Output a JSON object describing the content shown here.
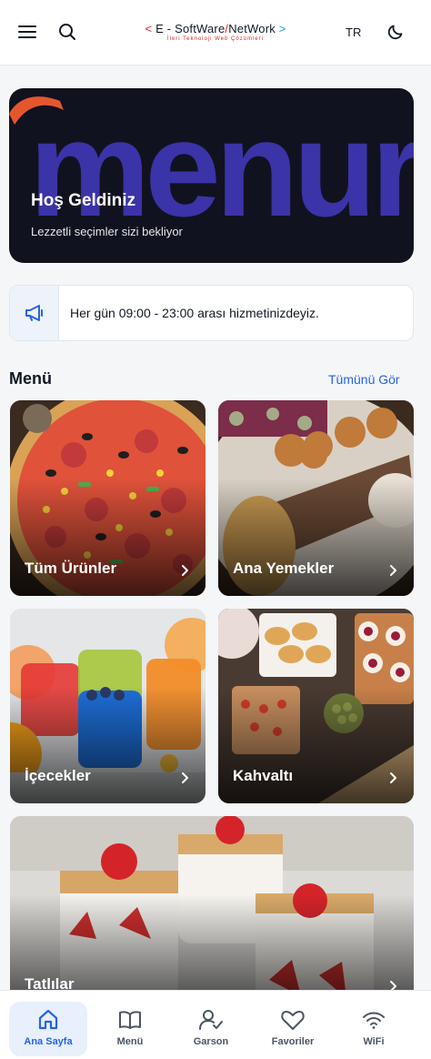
{
  "header": {
    "menu_icon": "hamburger-icon",
    "search_icon": "search-icon",
    "logo": {
      "text_left": "E - SoftWare",
      "text_right": "NetWork",
      "tagline": "İleri Teknoloji Web Çözümleri"
    },
    "language": "TR",
    "theme_icon": "moon-icon"
  },
  "hero": {
    "background_word": "menur",
    "title": "Hoş Geldiniz",
    "subtitle": "Lezzetli seçimler sizi bekliyor"
  },
  "notice": {
    "icon": "megaphone-icon",
    "text": "Her gün 09:00 - 23:00 arası hizmetinizdeyiz."
  },
  "menu_section": {
    "title": "Menü",
    "see_all": "Tümünü Gör",
    "categories": [
      {
        "label": "Tüm Ürünler",
        "image": "pizza"
      },
      {
        "label": "Ana Yemekler",
        "image": "kebab"
      },
      {
        "label": "İçecekler",
        "image": "colorful-drinks"
      },
      {
        "label": "Kahvaltı",
        "image": "breakfast-spread"
      },
      {
        "label": "Tatlılar",
        "image": "strawberry-dessert-jars"
      }
    ]
  },
  "bottom_nav": {
    "items": [
      {
        "label": "Ana Sayfa",
        "icon": "home-icon",
        "active": true
      },
      {
        "label": "Menü",
        "icon": "book-icon",
        "active": false
      },
      {
        "label": "Garson",
        "icon": "user-check-icon",
        "active": false
      },
      {
        "label": "Favoriler",
        "icon": "heart-icon",
        "active": false
      },
      {
        "label": "WiFi",
        "icon": "wifi-icon",
        "active": false
      }
    ]
  },
  "colors": {
    "accent": "#2563eb",
    "hero_bg": "#11121f",
    "hero_word": "#3b33a8",
    "logo_red": "#dc2626",
    "logo_blue": "#0ea5e9"
  }
}
